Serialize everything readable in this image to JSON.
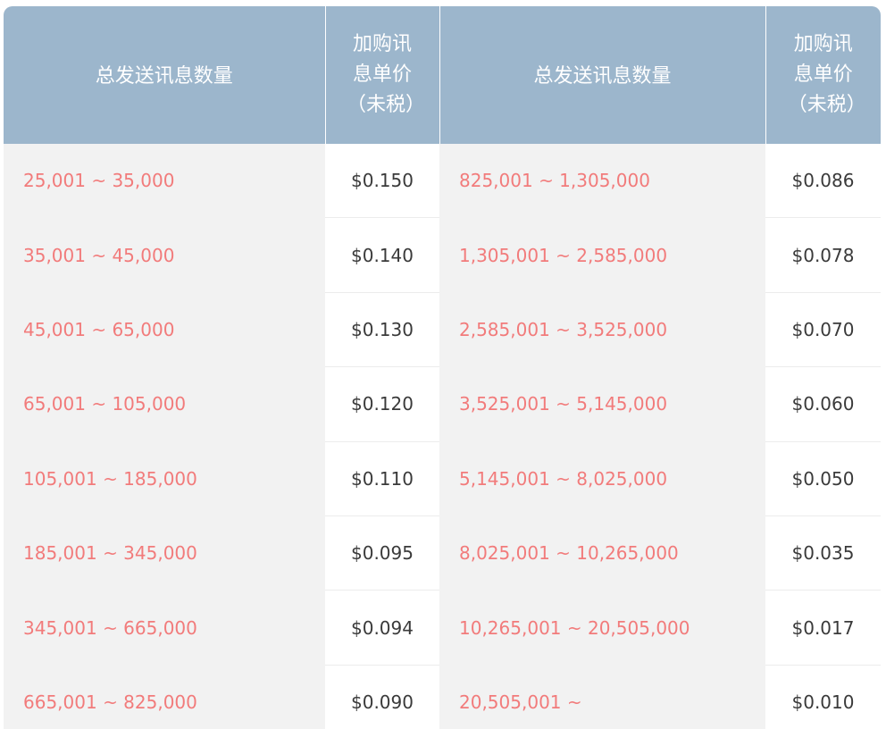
{
  "header": {
    "range_label": "总发送讯息数量",
    "price_label": "加购讯息单价（未税）"
  },
  "rows": [
    {
      "left_range": "25,001 ~ 35,000",
      "left_price": "$0.150",
      "right_range": "825,001 ~ 1,305,000",
      "right_price": "$0.086"
    },
    {
      "left_range": "35,001 ~ 45,000",
      "left_price": "$0.140",
      "right_range": "1,305,001 ~ 2,585,000",
      "right_price": "$0.078"
    },
    {
      "left_range": "45,001 ~ 65,000",
      "left_price": "$0.130",
      "right_range": "2,585,001 ~ 3,525,000",
      "right_price": "$0.070"
    },
    {
      "left_range": "65,001 ~ 105,000",
      "left_price": "$0.120",
      "right_range": "3,525,001 ~ 5,145,000",
      "right_price": "$0.060"
    },
    {
      "left_range": "105,001 ~ 185,000",
      "left_price": "$0.110",
      "right_range": "5,145,001 ~ 8,025,000",
      "right_price": "$0.050"
    },
    {
      "left_range": "185,001 ~ 345,000",
      "left_price": "$0.095",
      "right_range": "8,025,001 ~ 10,265,000",
      "right_price": "$0.035"
    },
    {
      "left_range": "345,001 ~ 665,000",
      "left_price": "$0.094",
      "right_range": "10,265,001 ~ 20,505,000",
      "right_price": "$0.017"
    },
    {
      "left_range": "665,001 ~ 825,000",
      "left_price": "$0.090",
      "right_range": "20,505,001 ~",
      "right_price": "$0.010"
    }
  ],
  "colors": {
    "header_bg": "#9cb6cc",
    "range_text": "#f27b7b",
    "price_text": "#3a3a3a",
    "range_bg": "#f2f2f2",
    "price_bg": "#ffffff"
  }
}
